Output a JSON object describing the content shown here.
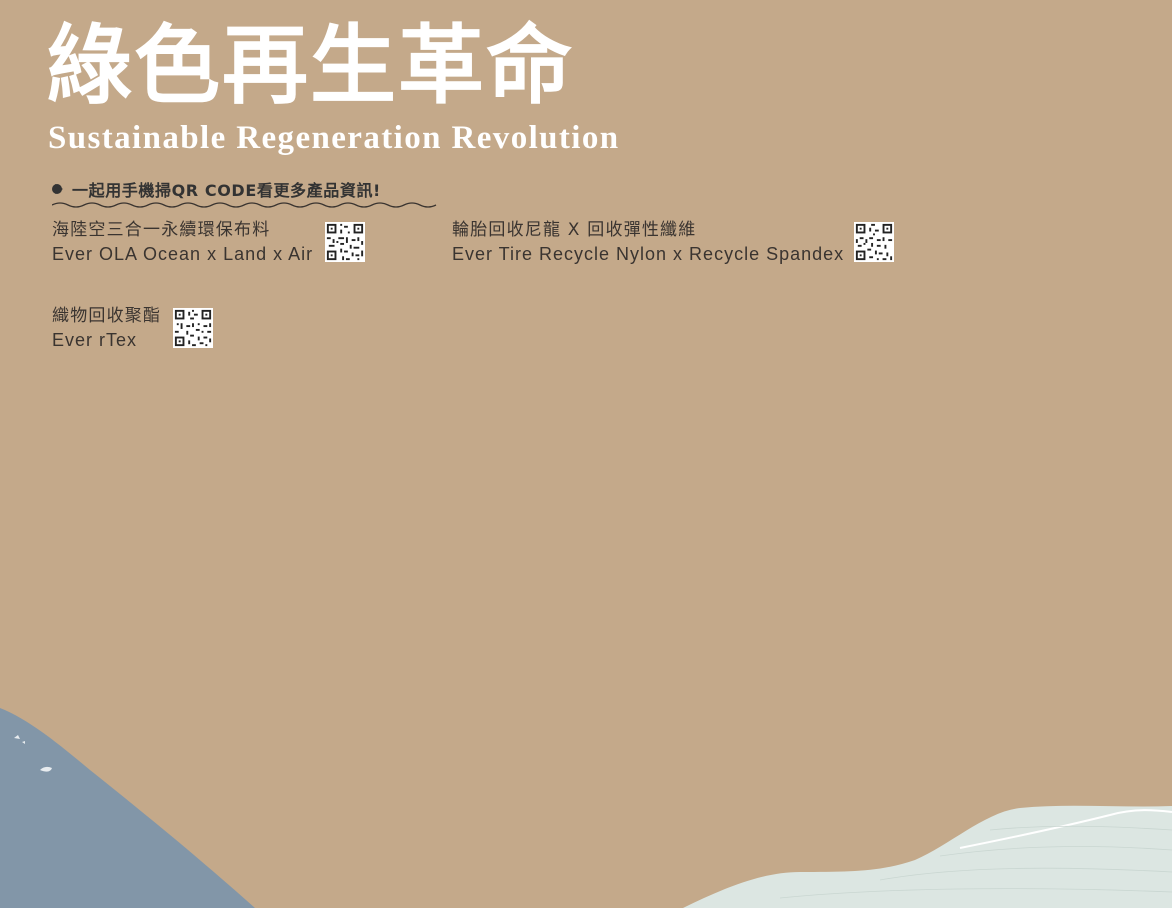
{
  "title": {
    "zh": "綠色再生革命",
    "en": "Sustainable Regeneration Revolution"
  },
  "scan_banner": {
    "text": "一起用手機掃QR CODE看更多產品資訊!",
    "icon": "play-triangle-icon"
  },
  "products": [
    {
      "name_zh": "海陸空三合一永續環保布料",
      "name_en": "Ever OLA Ocean x Land x Air",
      "qr_icon": "qr-code-icon"
    },
    {
      "name_zh": "輪胎回收尼龍 X 回收彈性纖維",
      "name_en": "Ever Tire Recycle Nylon x Recycle Spandex",
      "qr_icon": "qr-code-icon"
    },
    {
      "name_zh": "織物回收聚酯",
      "name_en": "Ever rTex",
      "qr_icon": "qr-code-icon"
    }
  ],
  "colors": {
    "background": "#c4a98a",
    "title": "#ffffff",
    "text": "#3a3430",
    "wave_blue": "#8296a8",
    "wave_mint": "#dce6e2"
  }
}
